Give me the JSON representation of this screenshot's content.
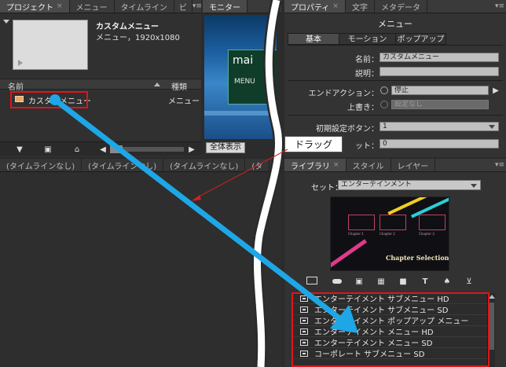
{
  "project_panel": {
    "tabs": [
      {
        "label": "プロジェクト",
        "close": "×"
      },
      {
        "label": "メニュー"
      },
      {
        "label": "タイムライン"
      },
      {
        "label": "ビ"
      }
    ],
    "menu_glyph": "▾≡",
    "asset_name": "カスタムメニュー",
    "asset_info": "メニュー，1920x1080",
    "col_name": "名前",
    "col_type": "種類",
    "row_name": "カスタムメニュー",
    "row_type": "メニュー"
  },
  "monitor_panel": {
    "tab": "モニター",
    "preview_text_1": "mai",
    "preview_text_2": "MENU",
    "fit_button": "全体表示"
  },
  "properties_panel": {
    "tabs": [
      {
        "label": "プロパティ",
        "close": "×"
      },
      {
        "label": "文字"
      },
      {
        "label": "メタデータ"
      }
    ],
    "title": "メニュー",
    "subtabs": [
      "基本",
      "モーション",
      "ポップアップ"
    ],
    "name_label": "名前：",
    "name_value": "カスタムメニュー",
    "desc_label": "説明：",
    "end_action_label": "エンドアクション：",
    "end_action_value": "停止",
    "override_label": "上書き：",
    "override_value": "設定なし",
    "default_button_label": "初期設定ボタン：",
    "default_button_value": "1",
    "offset_label": "ット：",
    "offset_value": "0"
  },
  "timeline_tabs": [
    "(タイムラインなし)",
    "(タイムラインなし)",
    "(タイムラインなし)",
    "(タ"
  ],
  "library_panel": {
    "tabs": [
      {
        "label": "ライブラリ",
        "close": "×"
      },
      {
        "label": "スタイル"
      },
      {
        "label": "レイヤー"
      }
    ],
    "set_label": "セット：",
    "set_value": "エンターテインメント",
    "thumb_title": "Chapter Selection",
    "thumb_chapters": [
      "Chapter 1",
      "Chapter 2",
      "Chapter 3"
    ],
    "items": [
      "エンターテイメント サブメニュー HD",
      "エンターテイメント サブメニュー SD",
      "エンターテイメント ポップアップ メニュー",
      "エンターテイメント メニュー HD",
      "エンターテイメント メニュー SD",
      "コーポレート サブメニュー SD"
    ],
    "toolbar_icons": [
      "menu-icon",
      "button-icon",
      "video-icon",
      "image-icon",
      "folder-icon",
      "text-icon",
      "pen-icon",
      "import-icon"
    ]
  },
  "callout": {
    "label": "ドラッグ"
  },
  "colors": {
    "highlight": "#e0141a",
    "arrow": "#1ea7e6",
    "callout_line": "#d02020"
  }
}
